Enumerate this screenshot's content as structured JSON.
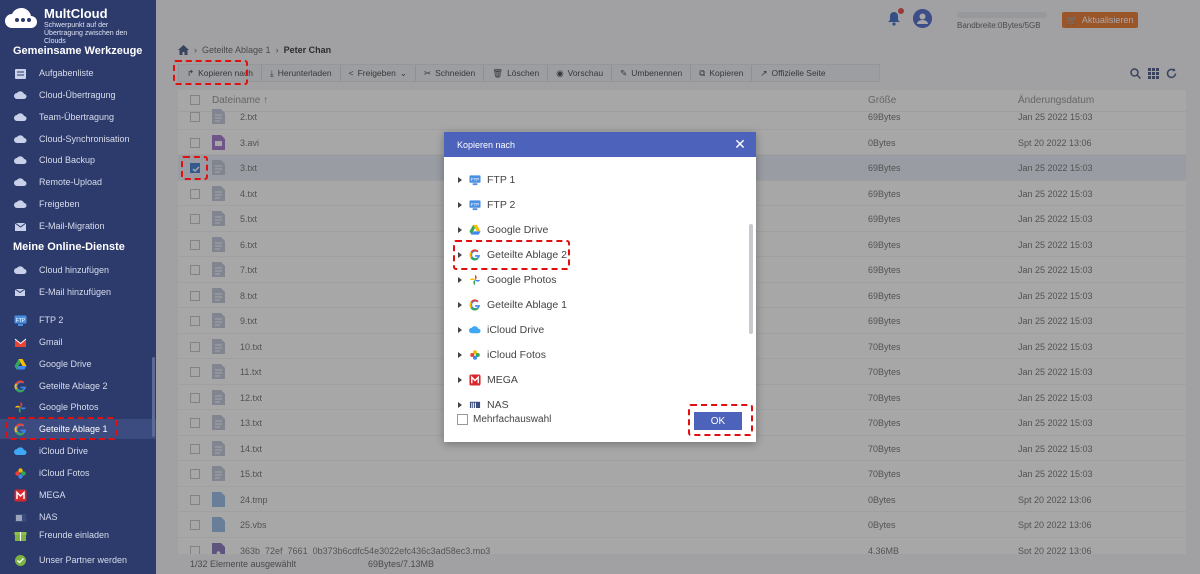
{
  "app": {
    "name": "MultCloud",
    "tagline": "Schwerpunkt auf der Übertragung zwischen den Clouds"
  },
  "sidebar": {
    "tools_title": "Gemeinsame Werkzeuge",
    "tools": [
      {
        "label": "Aufgabenliste",
        "icon": "list-icon"
      },
      {
        "label": "Cloud-Übertragung",
        "icon": "cloud-transfer-icon"
      },
      {
        "label": "Team-Übertragung",
        "icon": "team-transfer-icon"
      },
      {
        "label": "Cloud-Synchronisation",
        "icon": "cloud-sync-icon"
      },
      {
        "label": "Cloud Backup",
        "icon": "cloud-backup-icon"
      },
      {
        "label": "Remote-Upload",
        "icon": "remote-upload-icon"
      },
      {
        "label": "Freigeben",
        "icon": "share-icon"
      },
      {
        "label": "E-Mail-Migration",
        "icon": "email-migration-icon"
      }
    ],
    "services_title": "Meine Online-Dienste",
    "service_actions": [
      {
        "label": "Cloud hinzufügen",
        "icon": "add-cloud-icon"
      },
      {
        "label": "E-Mail hinzufügen",
        "icon": "add-email-icon"
      }
    ],
    "services": [
      {
        "label": "FTP 2",
        "icon": "ftp-icon"
      },
      {
        "label": "Gmail",
        "icon": "gmail-icon"
      },
      {
        "label": "Google Drive",
        "icon": "google-drive-icon"
      },
      {
        "label": "Geteilte Ablage 2",
        "icon": "google-icon"
      },
      {
        "label": "Google Photos",
        "icon": "google-photos-icon"
      },
      {
        "label": "Geteilte Ablage 1",
        "icon": "google-icon"
      },
      {
        "label": "iCloud Drive",
        "icon": "icloud-icon"
      },
      {
        "label": "iCloud Fotos",
        "icon": "icloud-photos-icon"
      },
      {
        "label": "MEGA",
        "icon": "mega-icon"
      },
      {
        "label": "NAS",
        "icon": "nas-icon"
      }
    ],
    "footer": [
      {
        "label": "Freunde einladen",
        "icon": "invite-icon"
      },
      {
        "label": "Unser Partner werden",
        "icon": "partner-icon"
      }
    ]
  },
  "topbar": {
    "bandwidth": "Bandbreite:0Bytes/5GB",
    "upgrade_label": "Aktualisieren"
  },
  "breadcrumb": {
    "parent": "Geteilte Ablage 1",
    "current": "Peter Chan"
  },
  "toolbar": {
    "copy_to": "Kopieren nach",
    "download": "Herunterladen",
    "share": "Freigeben",
    "cut": "Schneiden",
    "delete": "Löschen",
    "preview": "Vorschau",
    "rename": "Umbenennen",
    "copy": "Kopieren",
    "official": "Offizielle Seite"
  },
  "table": {
    "col_name": "Dateiname",
    "col_size": "Größe",
    "col_date": "Änderungsdatum",
    "rows": [
      {
        "name": "2.txt",
        "size": "69Bytes",
        "date": "Jan 25 2022 15:03",
        "type": "txt",
        "selected": false
      },
      {
        "name": "3.avi",
        "size": "0Bytes",
        "date": "Spt 20 2022 13:06",
        "type": "video",
        "selected": false
      },
      {
        "name": "3.txt",
        "size": "69Bytes",
        "date": "Jan 25 2022 15:03",
        "type": "txt",
        "selected": true
      },
      {
        "name": "4.txt",
        "size": "69Bytes",
        "date": "Jan 25 2022 15:03",
        "type": "txt",
        "selected": false
      },
      {
        "name": "5.txt",
        "size": "69Bytes",
        "date": "Jan 25 2022 15:03",
        "type": "txt",
        "selected": false
      },
      {
        "name": "6.txt",
        "size": "69Bytes",
        "date": "Jan 25 2022 15:03",
        "type": "txt",
        "selected": false
      },
      {
        "name": "7.txt",
        "size": "69Bytes",
        "date": "Jan 25 2022 15:03",
        "type": "txt",
        "selected": false
      },
      {
        "name": "8.txt",
        "size": "69Bytes",
        "date": "Jan 25 2022 15:03",
        "type": "txt",
        "selected": false
      },
      {
        "name": "9.txt",
        "size": "69Bytes",
        "date": "Jan 25 2022 15:03",
        "type": "txt",
        "selected": false
      },
      {
        "name": "10.txt",
        "size": "70Bytes",
        "date": "Jan 25 2022 15:03",
        "type": "txt",
        "selected": false
      },
      {
        "name": "11.txt",
        "size": "70Bytes",
        "date": "Jan 25 2022 15:03",
        "type": "txt",
        "selected": false
      },
      {
        "name": "12.txt",
        "size": "70Bytes",
        "date": "Jan 25 2022 15:03",
        "type": "txt",
        "selected": false
      },
      {
        "name": "13.txt",
        "size": "70Bytes",
        "date": "Jan 25 2022 15:03",
        "type": "txt",
        "selected": false
      },
      {
        "name": "14.txt",
        "size": "70Bytes",
        "date": "Jan 25 2022 15:03",
        "type": "txt",
        "selected": false
      },
      {
        "name": "15.txt",
        "size": "70Bytes",
        "date": "Jan 25 2022 15:03",
        "type": "txt",
        "selected": false
      },
      {
        "name": "24.tmp",
        "size": "0Bytes",
        "date": "Spt 20 2022 13:06",
        "type": "blank",
        "selected": false
      },
      {
        "name": "25.vbs",
        "size": "0Bytes",
        "date": "Spt 20 2022 13:06",
        "type": "blank",
        "selected": false
      },
      {
        "name": "363b_72ef_7661_0b373b6cdfc54e3022efc436c3ad58ec3.mp3",
        "size": "4.36MB",
        "date": "Spt 20 2022 13:06",
        "type": "audio",
        "selected": false
      }
    ]
  },
  "status": {
    "selection": "1/32 Elemente ausgewählt",
    "size": "69Bytes/7.13MB"
  },
  "dialog": {
    "title": "Kopieren nach",
    "items": [
      {
        "label": "FTP 1",
        "icon": "ftp-icon"
      },
      {
        "label": "FTP 2",
        "icon": "ftp-icon"
      },
      {
        "label": "Google Drive",
        "icon": "google-drive-icon"
      },
      {
        "label": "Geteilte Ablage 2",
        "icon": "google-icon"
      },
      {
        "label": "Google Photos",
        "icon": "google-photos-icon"
      },
      {
        "label": "Geteilte Ablage 1",
        "icon": "google-icon"
      },
      {
        "label": "iCloud Drive",
        "icon": "icloud-icon"
      },
      {
        "label": "iCloud Fotos",
        "icon": "icloud-photos-icon"
      },
      {
        "label": "MEGA",
        "icon": "mega-icon"
      },
      {
        "label": "NAS",
        "icon": "nas-icon"
      }
    ],
    "multi_select": "Mehrfachauswahl",
    "ok": "OK"
  },
  "colors": {
    "sidebar_bg": "#2c3a6c",
    "accent": "#4d62ba",
    "upgrade": "#e86b1a",
    "highlight": "#e01010"
  }
}
